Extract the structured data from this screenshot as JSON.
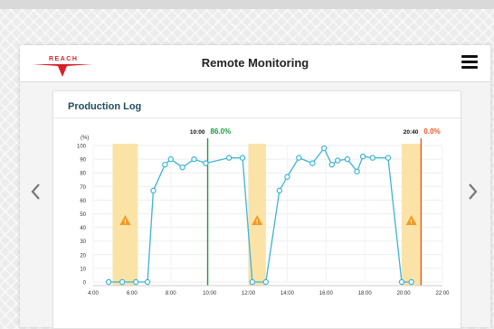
{
  "header": {
    "title": "Remote Monitoring",
    "logo_text": "REACH"
  },
  "card": {
    "title": "Production Log"
  },
  "colors": {
    "line": "#3cb4d6",
    "band": "#fbe3a8",
    "warning": "#f29b26",
    "marker_start": "#1d9a3a",
    "marker_end": "#e9572b",
    "brand": "#d81f2a"
  },
  "chart_data": {
    "type": "line",
    "ylabel": "(%)",
    "ylim": [
      0,
      100
    ],
    "yticks": [
      "0",
      "10",
      "20",
      "30",
      "40",
      "50",
      "60",
      "70",
      "80",
      "90",
      "100"
    ],
    "xlim": [
      4,
      22
    ],
    "xticks": [
      "4:00",
      "6:00",
      "8:00",
      "10:00",
      "12:00",
      "14:00",
      "16:00",
      "18:00",
      "20:00",
      "22:00"
    ],
    "xtick_values": [
      4,
      6,
      8,
      10,
      12,
      14,
      16,
      18,
      20,
      22
    ],
    "series": [
      {
        "x": [
          4.8,
          5.5,
          6.2,
          6.8,
          7.1,
          7.7,
          8.0,
          8.6,
          9.2,
          9.8,
          11.0,
          11.7,
          12.2,
          12.9,
          13.6,
          14.0,
          14.6,
          15.3,
          15.9,
          16.3,
          16.6,
          17.1,
          17.6,
          17.9,
          18.4,
          19.2,
          19.9,
          20.4
        ],
        "y": [
          0,
          0,
          0,
          0,
          67,
          86,
          90,
          84,
          90,
          87,
          91,
          91,
          0,
          0,
          67,
          77,
          91,
          87,
          98,
          86,
          89,
          90,
          81,
          92,
          91,
          91,
          0,
          0
        ]
      }
    ],
    "downtime_bands": [
      [
        5.0,
        6.3
      ],
      [
        12.0,
        12.9
      ],
      [
        19.9,
        20.9
      ]
    ],
    "markers": [
      {
        "x": 9.9,
        "time": "10:00",
        "value": "86.0%",
        "color": "#1d9a3a"
      },
      {
        "x": 20.9,
        "time": "20:40",
        "value": "0.0%",
        "color": "#e9572b"
      }
    ],
    "grid": true,
    "legend": "none"
  }
}
